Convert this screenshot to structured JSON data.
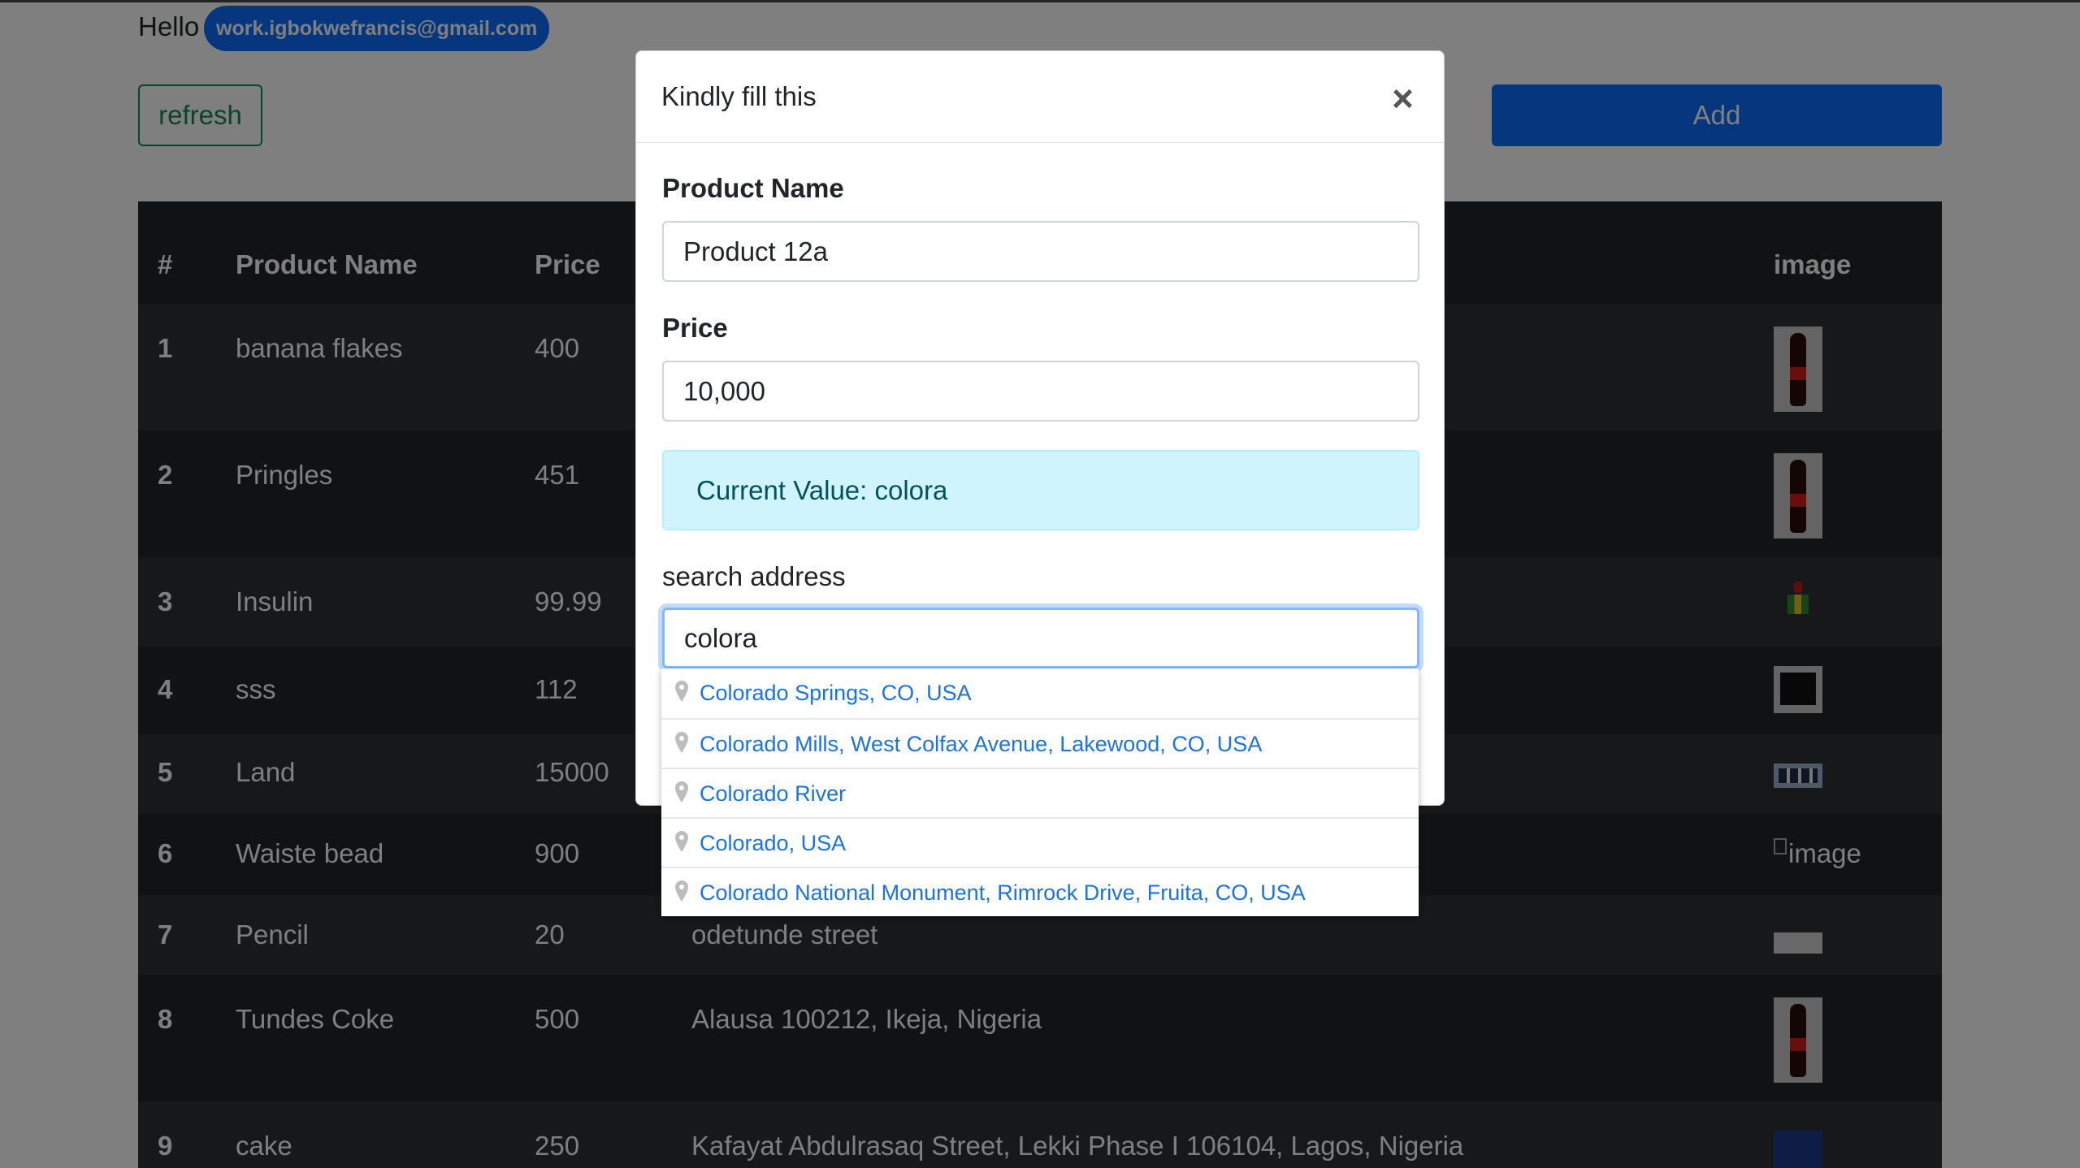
{
  "greeting": "Hello",
  "user_email": "work.igbokwefrancis@gmail.com",
  "buttons": {
    "refresh": "refresh",
    "add": "Add"
  },
  "table": {
    "headers": [
      "#",
      "Product Name",
      "Price",
      "image"
    ],
    "rows": [
      {
        "num": "1",
        "name": "banana flakes",
        "price": "400",
        "address": "",
        "image": "coke-bottle"
      },
      {
        "num": "2",
        "name": "Pringles",
        "price": "451",
        "address": "",
        "image": "coke-bottle"
      },
      {
        "num": "3",
        "name": "Insulin",
        "price": "99.99",
        "address": "",
        "image": "small-figure"
      },
      {
        "num": "4",
        "name": "sss",
        "price": "112",
        "address": "",
        "image": "dark-screen"
      },
      {
        "num": "5",
        "name": "Land",
        "price": "15000",
        "address": "",
        "image": "strip"
      },
      {
        "num": "6",
        "name": "Waiste bead",
        "price": "900",
        "address": "",
        "image": "broken",
        "image_alt": "image"
      },
      {
        "num": "7",
        "name": "Pencil",
        "price": "20",
        "address": "odetunde street",
        "image": "grey-bar"
      },
      {
        "num": "8",
        "name": "Tundes Coke",
        "price": "500",
        "address": "Alausa 100212, Ikeja, Nigeria",
        "image": "coke-bottle"
      },
      {
        "num": "9",
        "name": "cake",
        "price": "250",
        "address": "Kafayat Abdulrasaq Street, Lekki Phase I 106104, Lagos, Nigeria",
        "image": "blue"
      }
    ]
  },
  "modal": {
    "title": "Kindly fill this",
    "close_symbol": "×",
    "product_name_label": "Product Name",
    "product_name_value": "Product 12a",
    "price_label": "Price",
    "price_value": "10,000",
    "current_value_text": "Current Value: colora",
    "search_label": "search address",
    "search_value": "colora"
  },
  "suggestions": [
    "Colorado Springs, CO, USA",
    "Colorado Mills, West Colfax Avenue, Lakewood, CO, USA",
    "Colorado River",
    "Colorado, USA",
    "Colorado National Monument, Rimrock Drive, Fruita, CO, USA"
  ],
  "colors": {
    "primary": "#0d6efd",
    "success": "#198754",
    "info_bg": "#cff4fc",
    "table_dark": "#212529",
    "link": "#1a73e8"
  }
}
